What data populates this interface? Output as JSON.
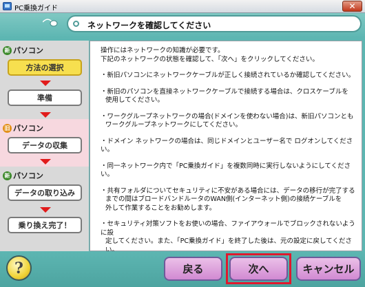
{
  "window": {
    "title": "PC乗換ガイド",
    "close_glyph": "✕"
  },
  "header": {
    "title": "ネットワークを確認してください"
  },
  "sidebar": {
    "sections": [
      {
        "badge": "新",
        "label": "パソコン"
      },
      {
        "badge": "旧",
        "label": "パソコン"
      },
      {
        "badge": "新",
        "label": "パソコン"
      }
    ],
    "steps": [
      {
        "label": "方法の選択",
        "active": true
      },
      {
        "label": "準備",
        "active": false
      },
      {
        "label": "データの収集",
        "active": false
      },
      {
        "label": "データの取り込み",
        "active": false
      },
      {
        "label": "乗り換え完了！",
        "active": false
      }
    ]
  },
  "content": {
    "intro": [
      "操作にはネットワークの知識が必要です。",
      "下記のネットワークの状態を確認して、「次へ」をクリックしてください。"
    ],
    "items": [
      [
        "・新旧パソコンにネットワークケーブルが正しく接続されているか確認してください。"
      ],
      [
        "・新旧のパソコンを直接ネットワークケーブルで接続する場合は、クロスケーブルを",
        "使用してください。"
      ],
      [
        "・ワークグループネットワークの場合(ドメインを使わない場合)は、新旧パソコンとも",
        "ワークグループネットワークにしてください。"
      ],
      [
        "・ドメイン ネットワークの場合は、同じドメインとユーザー名で ログオンしてください。"
      ],
      [
        "・同一ネットワーク内で「PC乗換ガイド」を複数同時に実行しないようにしてください。"
      ],
      [
        "・共有フォルダについてセキュリティに不安がある場合には、データの移行が完了する",
        "までの間はブロードバンドルータのWAN側(インターネット側)の接続ケーブルを",
        "外して作業することをお勧めします。"
      ],
      [
        "・セキュリティ対策ソフトをお使いの場合、ファイアウォールでブロックされないように設",
        "定してください。また、「PC乗換ガイド」を終了した後は、元の設定に戻してください。"
      ]
    ]
  },
  "footer": {
    "help_label": "?",
    "back_label": "戻る",
    "next_label": "次へ",
    "cancel_label": "キャンセル"
  },
  "colors": {
    "frame": "#5db6b2",
    "active_step": "#f7df4f",
    "arrow": "#e11b1b",
    "old_section": "#f7d8df",
    "nav_button": "#d18ad2",
    "highlight_border": "#e0182d"
  }
}
